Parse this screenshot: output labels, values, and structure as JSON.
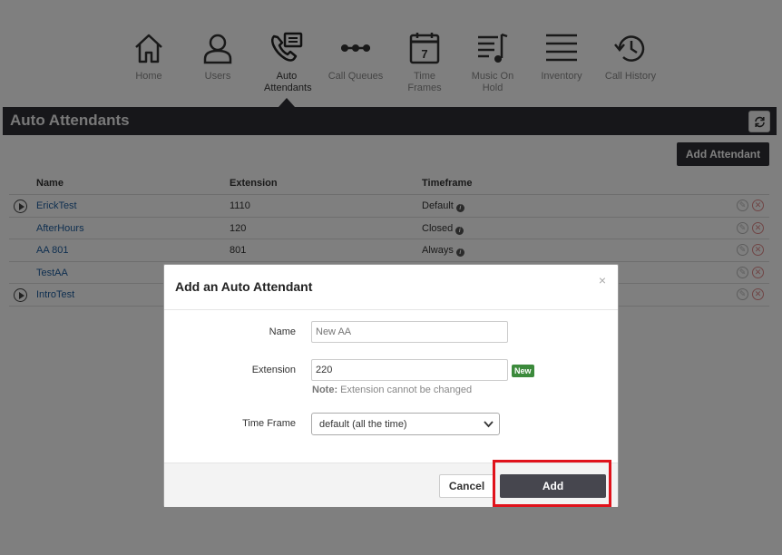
{
  "nav": {
    "items": [
      {
        "label": "Home",
        "icon": "home-icon"
      },
      {
        "label": "Users",
        "icon": "user-icon"
      },
      {
        "label": "Auto Attendants",
        "icon": "phone-menu-icon"
      },
      {
        "label": "Call Queues",
        "icon": "call-queue-icon"
      },
      {
        "label": "Time Frames",
        "icon": "calendar-icon"
      },
      {
        "label": "Music On Hold",
        "icon": "music-icon"
      },
      {
        "label": "Inventory",
        "icon": "list-icon"
      },
      {
        "label": "Call History",
        "icon": "history-icon"
      }
    ],
    "active": "Auto Attendants"
  },
  "page": {
    "title": "Auto Attendants",
    "add_button": "Add Attendant"
  },
  "table": {
    "headers": {
      "name": "Name",
      "extension": "Extension",
      "timeframe": "Timeframe"
    },
    "rows": [
      {
        "name": "ErickTest",
        "extension": "1110",
        "timeframe": "Default",
        "has_audio": true
      },
      {
        "name": "AfterHours",
        "extension": "120",
        "timeframe": "Closed",
        "has_audio": false
      },
      {
        "name": "AA 801",
        "extension": "801",
        "timeframe": "Always",
        "has_audio": false
      },
      {
        "name": "TestAA",
        "extension": "",
        "timeframe": "",
        "has_audio": false
      },
      {
        "name": "IntroTest",
        "extension": "",
        "timeframe": "",
        "has_audio": true
      }
    ]
  },
  "modal": {
    "title": "Add an Auto Attendant",
    "close": "×",
    "name_label": "Name",
    "name_placeholder": "New AA",
    "extension_label": "Extension",
    "extension_value": "220",
    "new_badge": "New",
    "note_prefix": "Note:",
    "note_text": " Extension cannot be changed",
    "timeframe_label": "Time Frame",
    "timeframe_value": "default (all the time)",
    "cancel_label": "Cancel",
    "add_label": "Add"
  },
  "colors": {
    "header_bg": "#2e2e34",
    "link": "#1f5fa0",
    "highlight": "#e0121b",
    "badge": "#3c8a3c"
  }
}
